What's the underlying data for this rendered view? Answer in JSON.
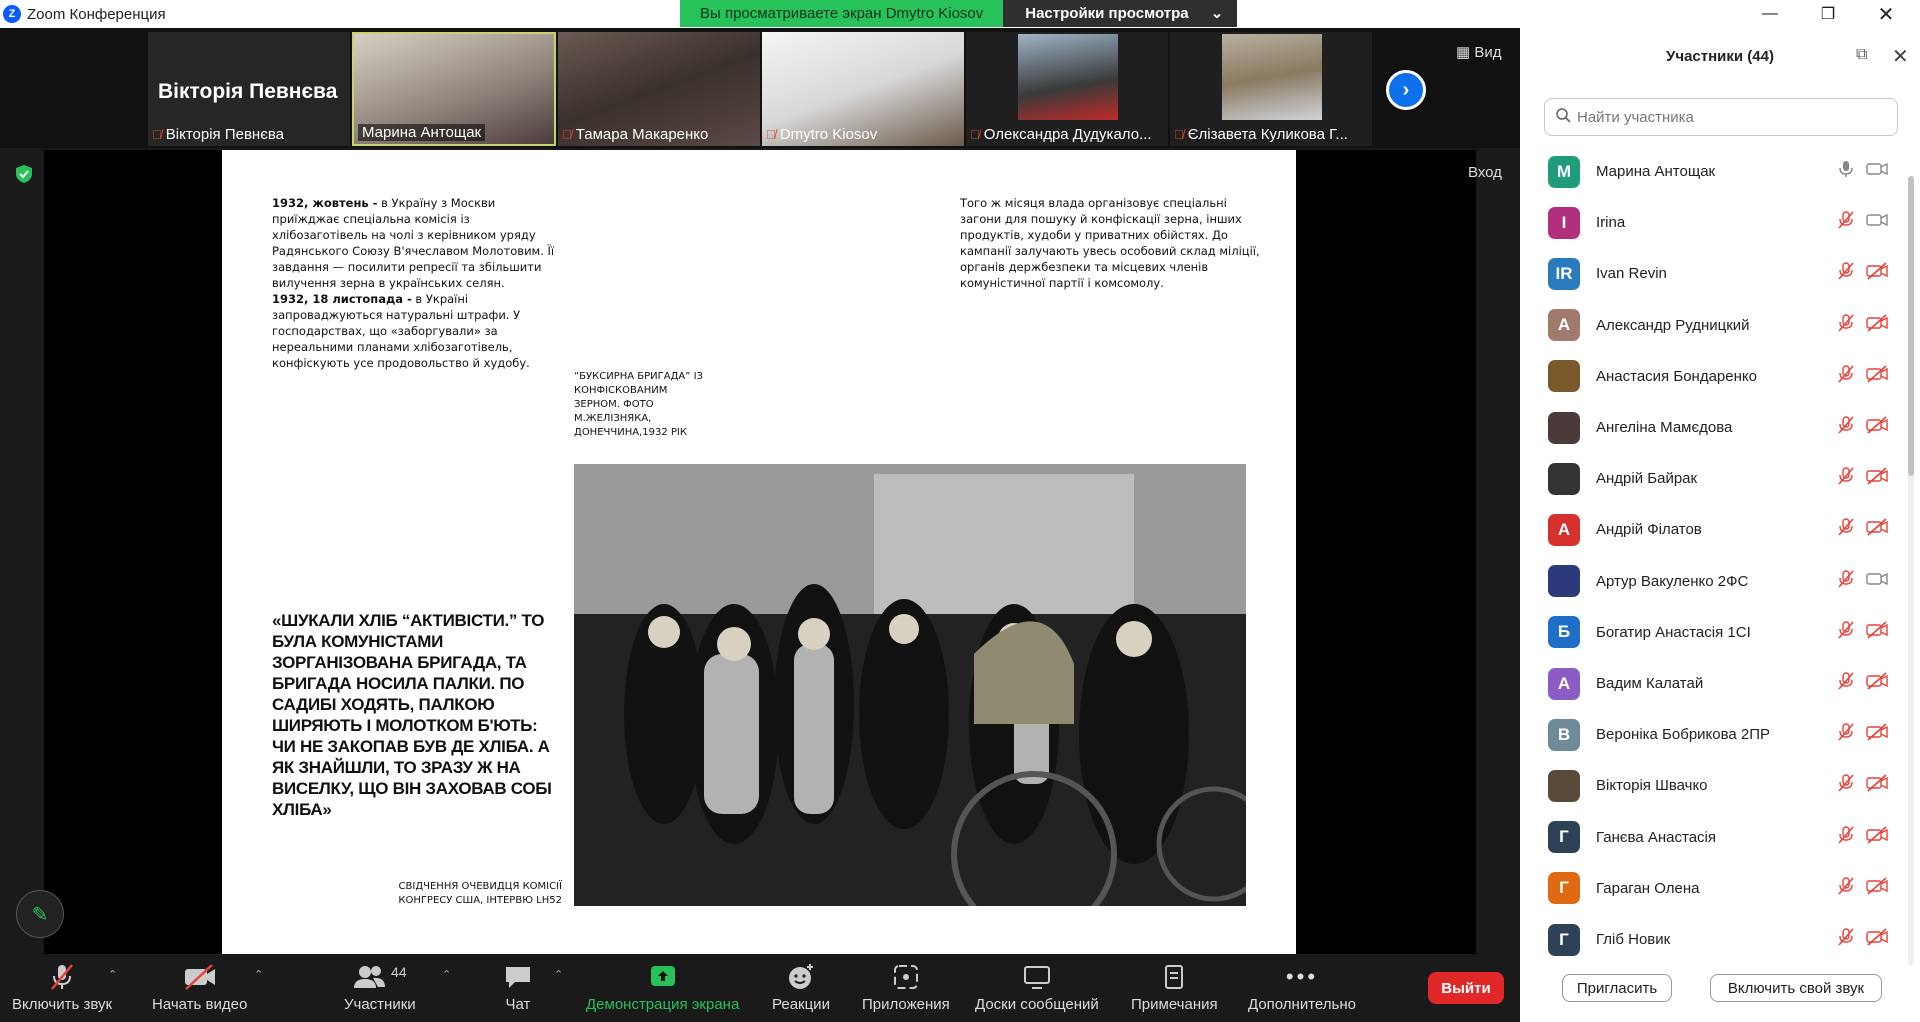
{
  "window": {
    "title": "Zoom Конференция",
    "share_banner": "Вы просматриваете экран Dmytro Kiosov",
    "view_settings": "Настройки просмотра"
  },
  "strip": {
    "active_speaker_big": "Вікторія Певнєва",
    "tiles": [
      {
        "name": "Вікторія Певнєва",
        "muted": true
      },
      {
        "name": "Марина Антощак",
        "muted": false
      },
      {
        "name": "Тамара Макаренко",
        "muted": true
      },
      {
        "name": "Dmytro Kiosov",
        "muted": true
      },
      {
        "name": "Олександра Дудукало...",
        "muted": true
      },
      {
        "name": "Єлізавета Куликова Г...",
        "muted": true
      }
    ],
    "view_label": "Вид"
  },
  "share": {
    "enter_label": "Вход",
    "doc": {
      "left_bold_1": "1932, жовтень -",
      "left_text_1": " в Україну з Москви приїжджає спеціальна комісія із хлібозаготівель на чолі з керівником уряду Радянського Союзу В'ячеславом Молотовим. Її завдання — посилити репресії та збільшити вилучення зерна в українських селян.",
      "left_bold_2": "1932, 18 листопада -",
      "left_text_2": " в Україні запроваджуються натуральні штрафи. У господарствах, що «заборгували» за нереальними планами хлібозаготівель, конфіскують усе продовольство й худобу.",
      "right_text": "Того ж місяця влада організовує спеціальні загони для пошуку й конфіскації зерна, інших продуктів, худоби у приватних обійстях. До кампанії залучають увесь особовий склад міліції, органів держбезпеки та місцевих членів комуністичної партії і комсомолу.",
      "caption": "“БУКСИРНА БРИГАДА” ІЗ КОНФІСКОВАНИМ ЗЕРНОМ. ФОТО М.ЖЕЛІЗНЯКА, ДОНЕЧЧИНА,1932 РІК",
      "quote": "«ШУКАЛИ ХЛІБ “АКТИВІСТИ.” ТО БУЛА КОМУНІСТАМИ ЗОРГАНІЗОВАНА БРИГАДА, ТА БРИГАДА НОСИЛА ПАЛКИ. ПО САДИБІ ХОДЯТЬ, ПАЛКОЮ ШИРЯЮТЬ І МОЛОТКОМ Б'ЮТЬ: ЧИ НЕ ЗАКОПАВ БУВ ДЕ ХЛІБА. А ЯК ЗНАЙШЛИ, ТО ЗРАЗУ Ж НА ВИСЕЛКУ, ЩО ВІН ЗАХОВАВ СОБІ ХЛІБА»",
      "source": "СВІДЧЕННЯ ОЧЕВИДЦЯ КОМІСІЇ КОНГРЕСУ США, ІНТЕРВЮ LH52"
    }
  },
  "toolbar": {
    "mute": "Включить звук",
    "video": "Начать видео",
    "participants": "Участники",
    "participants_count": "44",
    "chat": "Чат",
    "share": "Демонстрация экрана",
    "reactions": "Реакции",
    "apps": "Приложения",
    "whiteboards": "Доски сообщений",
    "notes": "Примечания",
    "more": "Дополнительно",
    "leave": "Выйти"
  },
  "panel": {
    "title": "Участники (44)",
    "search_placeholder": "Найти участника",
    "invite": "Пригласить",
    "unmute_me": "Включить свой звук",
    "participants": [
      {
        "initial": "М",
        "color": "#1f9c7a",
        "name": "Марина Антощак",
        "mic": "on",
        "cam": "off-gray"
      },
      {
        "initial": "I",
        "color": "#b0307e",
        "name": "Irina",
        "mic": "muted",
        "cam": "off-gray"
      },
      {
        "initial": "IR",
        "color": "#2a7bbd",
        "name": "Ivan Revin",
        "mic": "muted",
        "cam": "off"
      },
      {
        "initial": "А",
        "color": "#a07a6a",
        "name": "Александр Рудницкий",
        "mic": "muted",
        "cam": "off"
      },
      {
        "initial": "",
        "color": "#7a5a2a",
        "name": "Анастасия Бондаренко",
        "mic": "muted",
        "cam": "off"
      },
      {
        "initial": "",
        "color": "#4a3a3a",
        "name": "Ангеліна Мамєдова",
        "mic": "muted",
        "cam": "off"
      },
      {
        "initial": "",
        "color": "#333333",
        "name": "Андрій Байрак",
        "mic": "muted",
        "cam": "off"
      },
      {
        "initial": "А",
        "color": "#d6312c",
        "name": "Андрій Філатов",
        "mic": "muted",
        "cam": "off"
      },
      {
        "initial": "",
        "color": "#2a3a7a",
        "name": "Артур Вакуленко 2ФС",
        "mic": "muted",
        "cam": "off-gray"
      },
      {
        "initial": "Б",
        "color": "#1e6fc7",
        "name": "Богатир Анастасія 1СІ",
        "mic": "muted",
        "cam": "off"
      },
      {
        "initial": "А",
        "color": "#8a5cc4",
        "name": "Вадим Калатай",
        "mic": "muted",
        "cam": "off"
      },
      {
        "initial": "В",
        "color": "#6f8a99",
        "name": "Вероніка Бобрикова 2ПР",
        "mic": "muted",
        "cam": "off"
      },
      {
        "initial": "",
        "color": "#5a4a3a",
        "name": "Вікторія Швачко",
        "mic": "muted",
        "cam": "off"
      },
      {
        "initial": "Г",
        "color": "#2f4156",
        "name": "Ганєва Анастасія",
        "mic": "muted",
        "cam": "off"
      },
      {
        "initial": "Г",
        "color": "#e06a12",
        "name": "Гараган Олена",
        "mic": "muted",
        "cam": "off"
      },
      {
        "initial": "Г",
        "color": "#2f4156",
        "name": "Гліб Новик",
        "mic": "muted",
        "cam": "off"
      }
    ]
  }
}
